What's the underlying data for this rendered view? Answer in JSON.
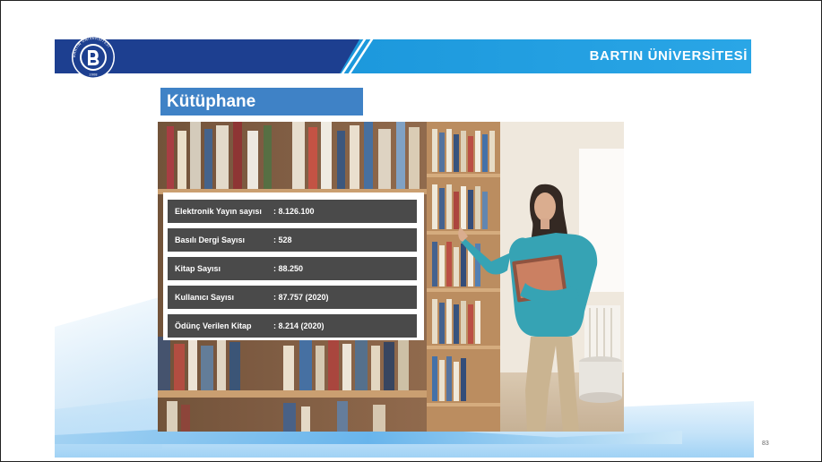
{
  "header": {
    "brand": "BARTIN ÜNİVERSİTESİ",
    "logo": {
      "ring_text": "BARTIN ÜNİVERSİTESİ",
      "year": "2008"
    }
  },
  "section": {
    "title": "Kütüphane"
  },
  "stats": [
    {
      "label": "Elektronik Yayın sayısı",
      "value": ": 8.126.100"
    },
    {
      "label": "Basılı Dergi Sayısı",
      "value": ": 528"
    },
    {
      "label": "Kitap Sayısı",
      "value": ": 88.250"
    },
    {
      "label": "Kullanıcı Sayısı",
      "value": ": 87.757 (2020)"
    },
    {
      "label": "Ödünç Verilen Kitap",
      "value": ": 8.214 (2020)"
    }
  ],
  "footer": {
    "page_number": "83"
  },
  "colors": {
    "header_dark": "#1d3f90",
    "header_light": "#1c98dc",
    "title_bg": "#3f82c6",
    "row_bg": "#4a4a4a"
  }
}
